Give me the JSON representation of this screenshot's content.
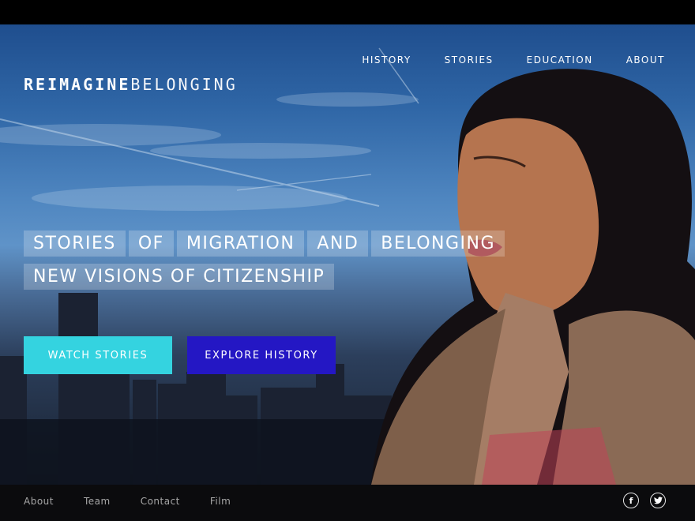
{
  "brand": {
    "part1": "REIMAGINE",
    "part2": "BELONGING"
  },
  "nav": {
    "items": [
      "HISTORY",
      "STORIES",
      "EDUCATION",
      "ABOUT"
    ]
  },
  "headline": {
    "row1": [
      "STORIES",
      "OF",
      "MIGRATION",
      "AND",
      "BELONGING"
    ],
    "row2": [
      "NEW VISIONS OF CITIZENSHIP"
    ]
  },
  "buttons": {
    "watch": "WATCH STORIES",
    "explore": "EXPLORE HISTORY"
  },
  "footer": {
    "links": [
      "About",
      "Team",
      "Contact",
      "Film"
    ]
  },
  "social": {
    "facebook": "f",
    "twitter": "t"
  },
  "colors": {
    "watch_button": "#34d3e0",
    "explore_button": "#2417c4",
    "footer_bg": "#0b0b0d"
  },
  "icons": [
    "facebook-icon",
    "twitter-icon"
  ]
}
